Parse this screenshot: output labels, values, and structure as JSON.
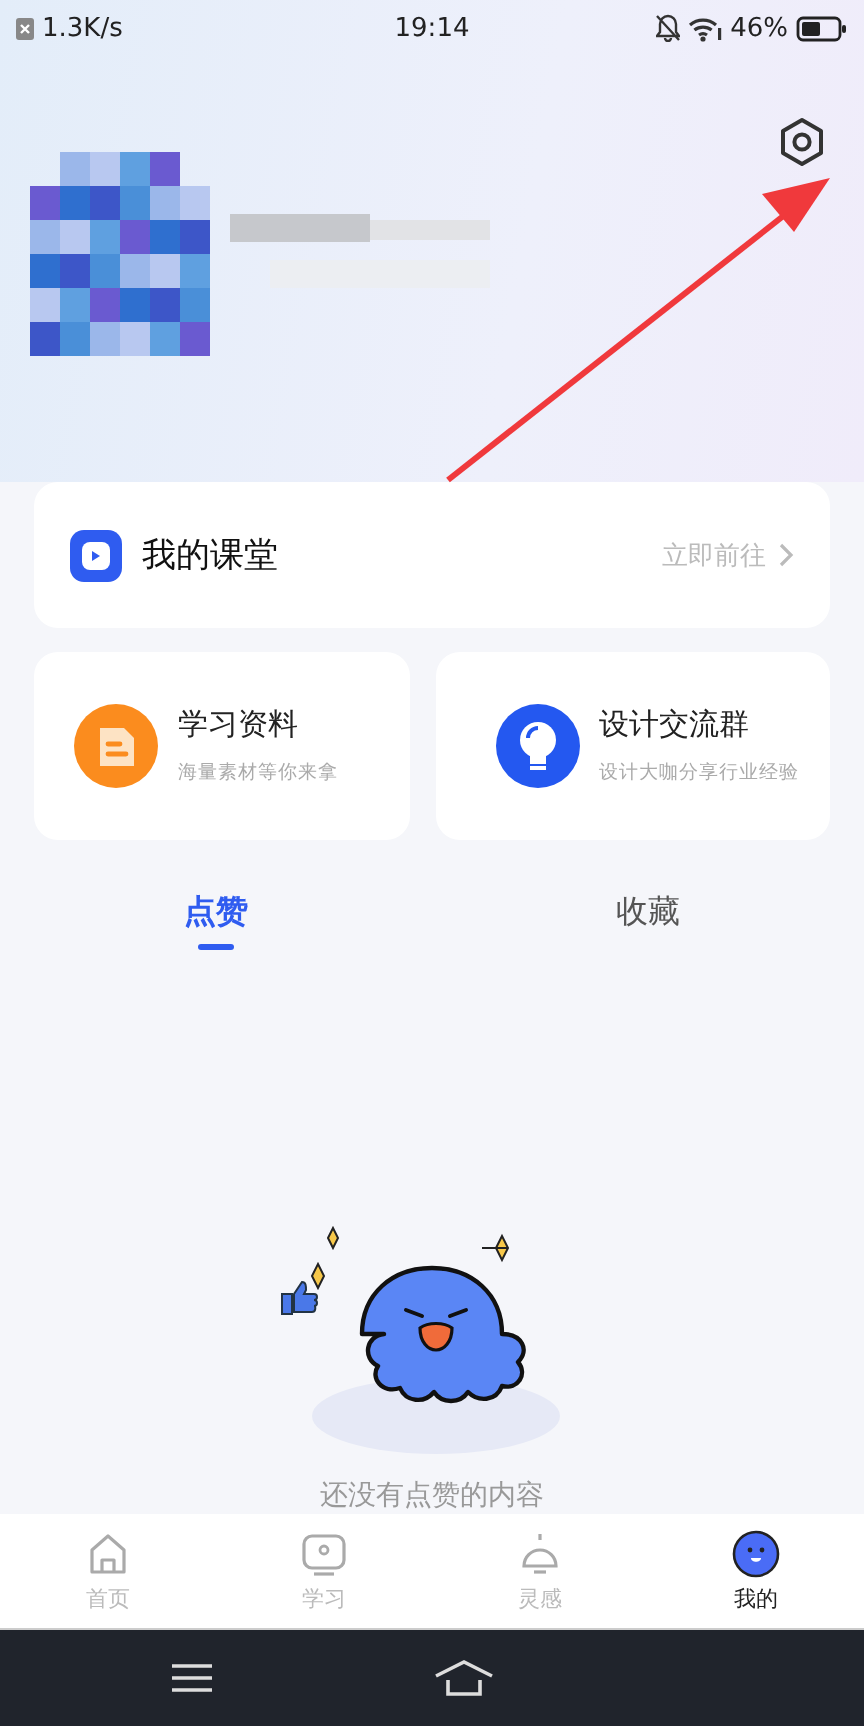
{
  "status_bar": {
    "network_speed": "1.3K/s",
    "time": "19:14",
    "battery": "46%"
  },
  "my_classroom": {
    "title": "我的课堂",
    "action": "立即前往"
  },
  "shortcuts": [
    {
      "kind": "document",
      "title": "学习资料",
      "subtitle": "海量素材等你来拿"
    },
    {
      "kind": "bulb",
      "title": "设计交流群",
      "subtitle": "设计大咖分享行业经验"
    }
  ],
  "tabs": [
    {
      "label": "点赞",
      "selected": true
    },
    {
      "label": "收藏",
      "selected": false
    }
  ],
  "empty_message": "还没有点赞的内容",
  "bottom_nav": [
    {
      "kind": "home",
      "label": "首页",
      "selected": false
    },
    {
      "kind": "study",
      "label": "学习",
      "selected": false
    },
    {
      "kind": "bell",
      "label": "灵感",
      "selected": false
    },
    {
      "kind": "me",
      "label": "我的",
      "selected": true
    }
  ]
}
